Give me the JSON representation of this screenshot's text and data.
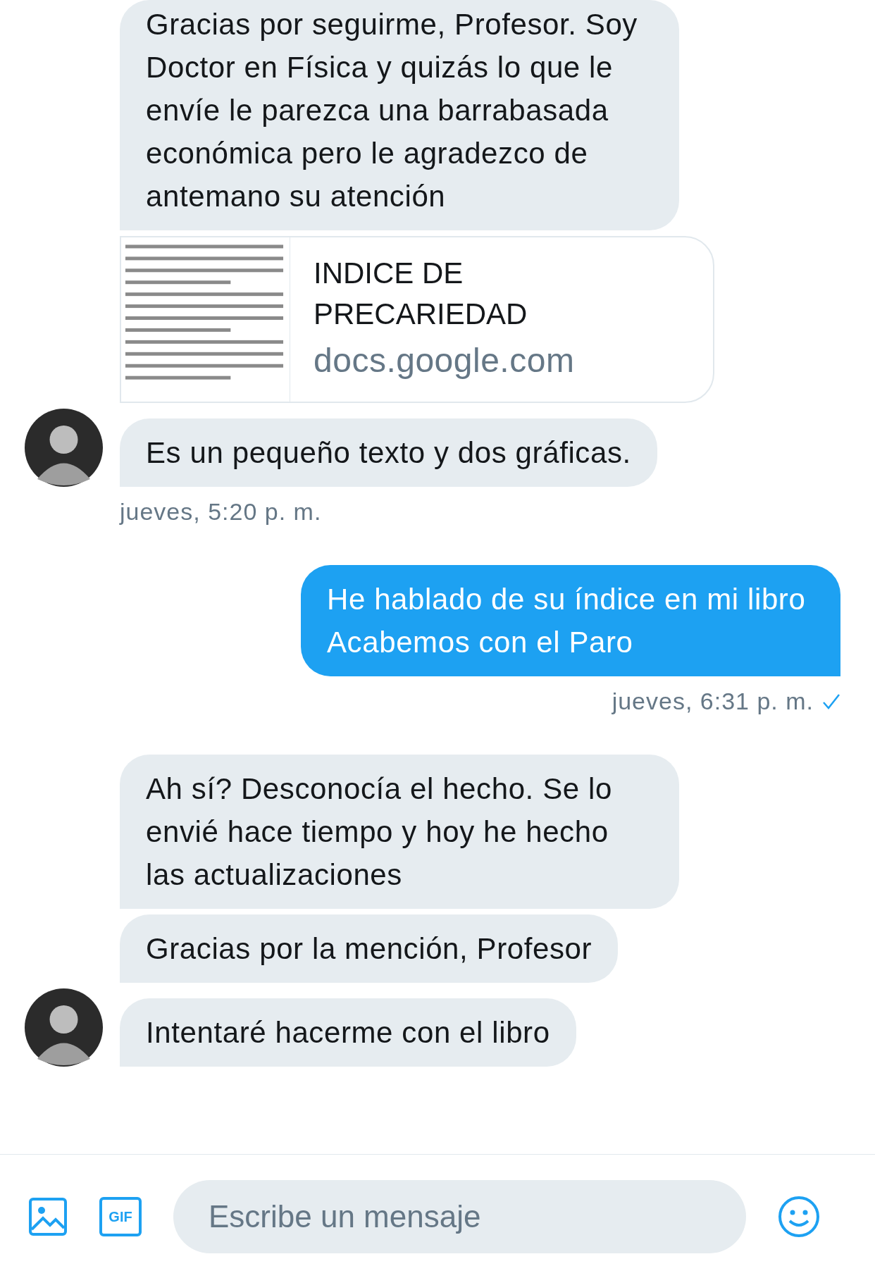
{
  "messages": [
    {
      "kind": "received",
      "avatar": false,
      "text": "Gracias por seguirme, Profesor. Soy Doctor en Física y quizás lo que le envíe le parezca una barrabasada económica pero le agradezco de antemano su atención"
    },
    {
      "kind": "link",
      "avatar": false,
      "title": "INDICE DE PRECARIEDAD",
      "domain": "docs.google.com"
    },
    {
      "kind": "received",
      "avatar": true,
      "text": "Es un pequeño texto y dos gráficas."
    },
    {
      "kind": "time_received",
      "text": "jueves, 5:20 p. m.",
      "seen": false
    },
    {
      "kind": "sent",
      "text": "He hablado de su índice en mi libro Acabemos con el Paro"
    },
    {
      "kind": "time_sent",
      "text": "jueves, 6:31 p. m.",
      "seen": true
    },
    {
      "kind": "received",
      "avatar": false,
      "text": "Ah sí? Desconocía el hecho. Se lo envié hace tiempo y hoy he hecho las actualizaciones"
    },
    {
      "kind": "received",
      "avatar": false,
      "text": "Gracias por la mención, Profesor"
    },
    {
      "kind": "received",
      "avatar": true,
      "text": "Intentaré hacerme con el libro"
    }
  ],
  "composer": {
    "gif_button": "GIF",
    "placeholder": "Escribe un mensaje"
  }
}
